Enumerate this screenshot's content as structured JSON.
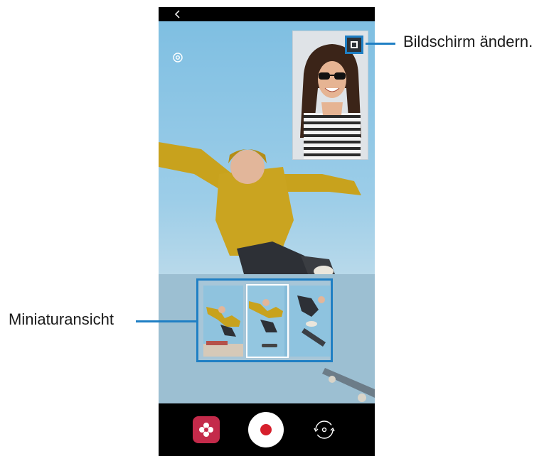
{
  "annotations": {
    "switch_screen_label": "Bildschirm ändern.",
    "thumbnail_label": "Miniaturansicht"
  },
  "camera": {
    "icons": {
      "back": "chevron-left-icon",
      "settings": "gear-icon",
      "switch_screen": "picture-in-picture-icon",
      "effects": "flower-effects-icon",
      "record": "record-icon",
      "flip": "flip-camera-icon"
    },
    "thumbnails": [
      {
        "id": "thumb-1"
      },
      {
        "id": "thumb-2",
        "selected": true
      },
      {
        "id": "thumb-3"
      }
    ],
    "colors": {
      "accent": "#1f7fc4",
      "record": "#d61f2c",
      "effects": "#c42a4a"
    }
  }
}
